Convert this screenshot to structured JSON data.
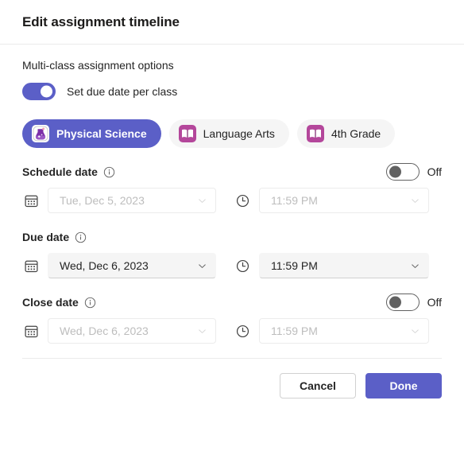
{
  "header": {
    "title": "Edit assignment timeline"
  },
  "multiclass": {
    "section_label": "Multi-class assignment options",
    "toggle_label": "Set due date per class",
    "toggle_on": true
  },
  "tabs": [
    {
      "label": "Physical Science",
      "icon": "science-flask-icon",
      "selected": true
    },
    {
      "label": "Language Arts",
      "icon": "open-book-icon",
      "selected": false
    },
    {
      "label": "4th Grade",
      "icon": "open-book-icon",
      "selected": false
    }
  ],
  "fields": [
    {
      "label": "Schedule date",
      "info_icon": "info-circle-icon",
      "has_toggle": true,
      "toggle_state_label": "Off",
      "toggle_on": false,
      "enabled": false,
      "date_icon": "calendar-icon",
      "date_value": "Tue, Dec 5, 2023",
      "time_icon": "clock-icon",
      "time_value": "11:59 PM"
    },
    {
      "label": "Due date",
      "info_icon": "info-circle-icon",
      "has_toggle": false,
      "toggle_state_label": "",
      "toggle_on": false,
      "enabled": true,
      "date_icon": "calendar-icon",
      "date_value": "Wed, Dec 6, 2023",
      "time_icon": "clock-icon",
      "time_value": "11:59 PM"
    },
    {
      "label": "Close date",
      "info_icon": "info-circle-icon",
      "has_toggle": true,
      "toggle_state_label": "Off",
      "toggle_on": false,
      "enabled": false,
      "date_icon": "calendar-icon",
      "date_value": "Wed, Dec 6, 2023",
      "time_icon": "clock-icon",
      "time_value": "11:59 PM"
    }
  ],
  "footer": {
    "cancel_label": "Cancel",
    "done_label": "Done"
  },
  "colors": {
    "accent": "#5b5fc7",
    "surface": "#ffffff",
    "field_fill": "#f5f5f5",
    "divider": "#ebebeb",
    "text": "#242424",
    "disabled_text": "#bdbdbd",
    "class_avatar_magenta": "#b4479b"
  }
}
